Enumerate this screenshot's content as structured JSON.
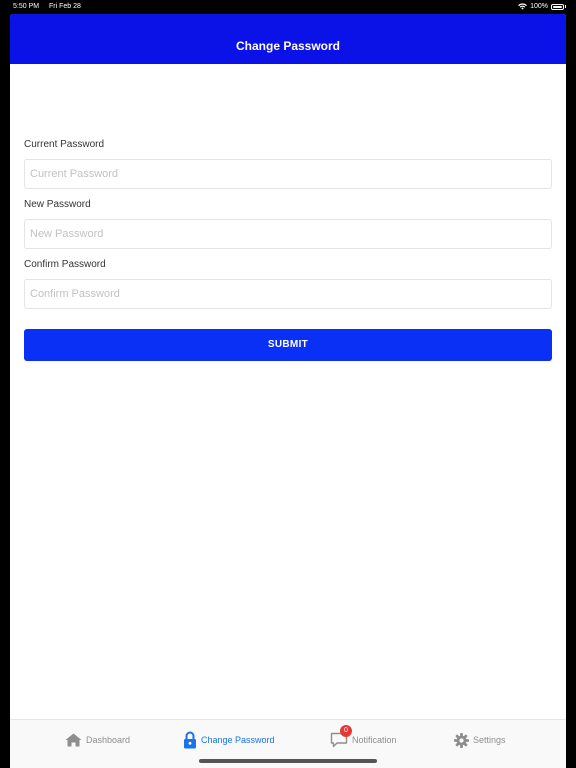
{
  "status_bar": {
    "time": "5:50 PM",
    "date": "Fri Feb 28",
    "battery": "100%"
  },
  "header": {
    "title": "Change Password"
  },
  "form": {
    "current_password": {
      "label": "Current Password",
      "placeholder": "Current Password",
      "value": ""
    },
    "new_password": {
      "label": "New Password",
      "placeholder": "New Password",
      "value": ""
    },
    "confirm_password": {
      "label": "Confirm Password",
      "placeholder": "Confirm Password",
      "value": ""
    },
    "submit_label": "SUBMIT"
  },
  "tab_bar": {
    "tabs": [
      {
        "label": "Dashboard",
        "icon": "home-icon",
        "active": false
      },
      {
        "label": "Change Password",
        "icon": "lock-icon",
        "active": true
      },
      {
        "label": "Notification",
        "icon": "chat-bubble-icon",
        "active": false,
        "badge": "0"
      },
      {
        "label": "Settings",
        "icon": "gear-icon",
        "active": false
      }
    ]
  },
  "colors": {
    "nav_bar": "#0a12e8",
    "submit_button": "#0a2ff5",
    "active_tab": "#1a73e8",
    "inactive_tab": "#8e8e8e",
    "badge": "#e53935"
  }
}
